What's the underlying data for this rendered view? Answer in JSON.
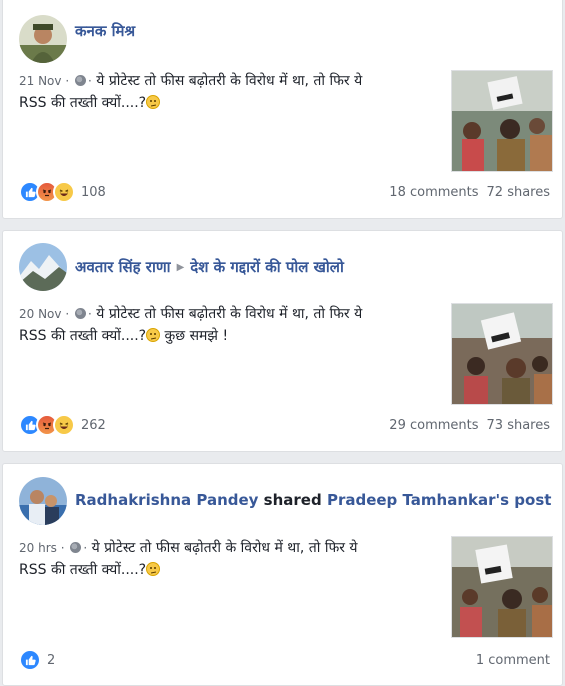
{
  "posts": [
    {
      "author": "कनक मिश्र",
      "time": "21 Nov",
      "text_line1": "ये प्रोटेस्ट तो फीस बढ़ोतरी के विरोध में था, तो फिर ये",
      "text_line2": "RSS की तख्ती क्यों....?",
      "text_suffix": "",
      "reaction_count": "108",
      "comments": "18 comments",
      "shares": "72 shares"
    },
    {
      "author": "अवतार सिंह राणा",
      "group": "देश के गद्दारों की पोल खोलो",
      "time": "20 Nov",
      "text_line1": "ये प्रोटेस्ट तो फीस बढ़ोतरी के विरोध में था, तो फिर ये",
      "text_line2": "RSS की तख्ती क्यों....?",
      "text_suffix": " कुछ समझे !",
      "reaction_count": "262",
      "comments": "29 comments",
      "shares": "73 shares"
    },
    {
      "author": "Radhakrishna Pandey",
      "shared_word": "shared",
      "shared_target": "Pradeep Tamhankar's post",
      "time": "20 hrs",
      "text_line1": "ये प्रोटेस्ट तो फीस बढ़ोतरी के विरोध में था, तो फिर ये",
      "text_line2": "RSS की तख्ती क्यों....?",
      "text_suffix": "",
      "reaction_count": "2",
      "comments": "1 comment"
    }
  ],
  "meta_sep": " · ",
  "dot_sep": "·",
  "icons": {
    "globe": "globe-icon",
    "like": "like-reaction-icon",
    "angry": "angry-reaction-icon",
    "haha": "haha-reaction-icon",
    "confused": "confused-emoji-icon"
  },
  "colors": {
    "link": "#385898",
    "like": "#2d88ff",
    "background": "#e9ebee"
  }
}
